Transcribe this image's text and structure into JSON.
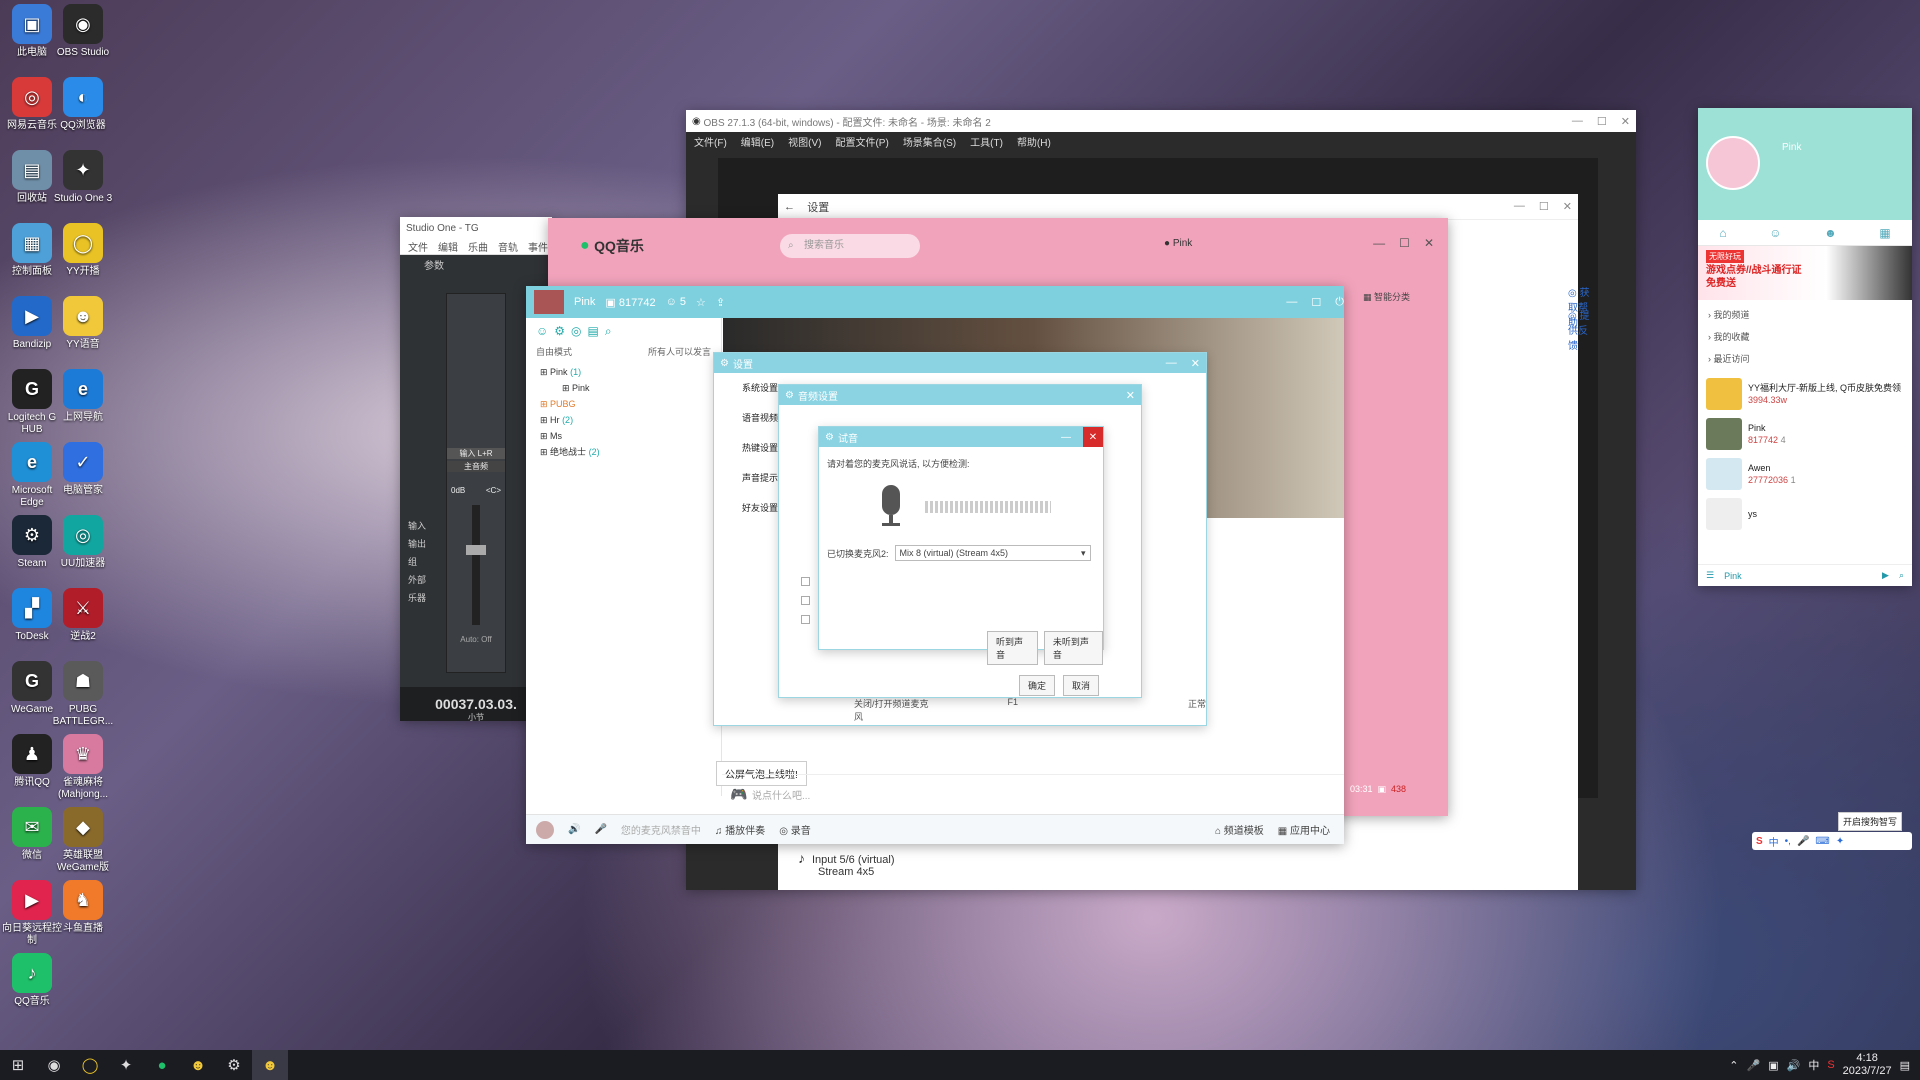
{
  "desktop": {
    "icons": [
      {
        "label": "此电脑",
        "color": "#3b7bd8",
        "glyph": "▣"
      },
      {
        "label": "OBS Studio",
        "color": "#2b2b2b",
        "glyph": "◉"
      },
      {
        "label": "网易云音乐",
        "color": "#d83a3a",
        "glyph": "◎"
      },
      {
        "label": "QQ浏览器",
        "color": "#2a8ce8",
        "glyph": "◐"
      },
      {
        "label": "回收站",
        "color": "#6f8fa8",
        "glyph": "▤"
      },
      {
        "label": "Studio One 3",
        "color": "#333",
        "glyph": "✦"
      },
      {
        "label": "控制面板",
        "color": "#4da0d8",
        "glyph": "▦"
      },
      {
        "label": "YY开播",
        "color": "#e9c325",
        "glyph": "◯"
      },
      {
        "label": "Bandizip",
        "color": "#2369c9",
        "glyph": "▶"
      },
      {
        "label": "YY语音",
        "color": "#f0c83a",
        "glyph": "☻"
      },
      {
        "label": "Logitech G HUB",
        "color": "#222",
        "glyph": "G"
      },
      {
        "label": "上网导航",
        "color": "#1d7bd8",
        "glyph": "e"
      },
      {
        "label": "Microsoft Edge",
        "color": "#1f8fd6",
        "glyph": "e"
      },
      {
        "label": "电脑管家",
        "color": "#2f6fe0",
        "glyph": "✓"
      },
      {
        "label": "Steam",
        "color": "#1b2838",
        "glyph": "⚙"
      },
      {
        "label": "UU加速器",
        "color": "#12a6a0",
        "glyph": "◎"
      },
      {
        "label": "ToDesk",
        "color": "#1f86e0",
        "glyph": "▞"
      },
      {
        "label": "逆战2",
        "color": "#b21d2a",
        "glyph": "⚔"
      },
      {
        "label": "WeGame",
        "color": "#333",
        "glyph": "G"
      },
      {
        "label": "PUBG BATTLEGR...",
        "color": "#5a5a5a",
        "glyph": "☗"
      },
      {
        "label": "腾讯QQ",
        "color": "#222",
        "glyph": "♟"
      },
      {
        "label": "雀魂麻将 (Mahjong...",
        "color": "#d87aa0",
        "glyph": "♛"
      },
      {
        "label": "微信",
        "color": "#2bb24c",
        "glyph": "✉"
      },
      {
        "label": "英雄联盟 WeGame版",
        "color": "#8a6a2b",
        "glyph": "◆"
      },
      {
        "label": "向日葵远程控制",
        "color": "#e0244d",
        "glyph": "▶"
      },
      {
        "label": "斗鱼直播",
        "color": "#f07a2a",
        "glyph": "♞"
      },
      {
        "label": "QQ音乐",
        "color": "#1fc06a",
        "glyph": "♪"
      }
    ]
  },
  "obs": {
    "title": "OBS 27.1.3 (64-bit, windows) - 配置文件: 未命名 - 场景: 未命名 2",
    "menus": [
      "文件(F)",
      "编辑(E)",
      "视图(V)",
      "配置文件(P)",
      "场景集合(S)",
      "工具(T)",
      "帮助(H)"
    ],
    "settings_title": "设置",
    "help_link": "获取帮助",
    "feedback_link": "提供反馈",
    "audio_device": "Input 5/6 (virtual)",
    "audio_stream": "Stream 4x5"
  },
  "studio_one": {
    "title": "Studio One - TG",
    "menus": [
      "文件",
      "编辑",
      "乐曲",
      "音轨",
      "事件"
    ],
    "tab": "参数",
    "input_label": "输入 L+R",
    "main_label": "主音频",
    "db": "0dB",
    "pan": "<C>",
    "side_labels": [
      "输入",
      "输出",
      "组",
      "外部",
      "乐器"
    ],
    "auto": "Auto: Off",
    "time": "00037.03.03.",
    "unit": "小节"
  },
  "qqmusic": {
    "brand": "QQ音乐",
    "search_placeholder": "搜索音乐",
    "user": "Pink",
    "smart": "智能分类"
  },
  "yy": {
    "user": "Pink",
    "uid": "817742",
    "count": "5",
    "mode": "自由模式",
    "notice": "所有人可以发言",
    "tree": [
      {
        "label": "Pink",
        "count": "(1)"
      },
      {
        "label": "Pink",
        "count": ""
      },
      {
        "label": "PUBG",
        "count": ""
      },
      {
        "label": "Hr",
        "count": "(2)"
      },
      {
        "label": "Ms",
        "count": ""
      },
      {
        "label": "绝地战士",
        "count": "(2)"
      }
    ],
    "settings_tabs": [
      "系统设置",
      "语音视频",
      "热键设置",
      "声音提示",
      "好友设置"
    ],
    "hotkey_label": "关闭/打开频道麦克风",
    "hotkey_key": "F1",
    "hotkey_status": "正常",
    "bubble": "公屏气泡上线啦!",
    "chat_placeholder": "说点什么吧...",
    "bottom": {
      "mic_status": "您的麦克风禁音中",
      "player": "播放伴奏",
      "record": "录音",
      "template": "频道模板",
      "apps": "应用中心"
    },
    "chat_stats": {
      "time": "03:31",
      "count": "438"
    }
  },
  "dialogs": {
    "settings": {
      "title": "设置"
    },
    "audio": {
      "title": "音频设置",
      "ok": "确定",
      "cancel": "取消"
    },
    "test": {
      "title": "试音",
      "prompt": "请对着您的麦克风说话, 以方便检测:",
      "switch_label": "已切换麦克风2:",
      "device": "Mix 8 (virtual) (Stream 4x5)",
      "heard": "听到声音",
      "not_heard": "未听到声音"
    }
  },
  "yy_panel": {
    "user": "Pink",
    "banner": "游戏点券//战斗通行证免费送",
    "banner_tag": "无限好玩",
    "sections": [
      "我的频道",
      "我的收藏",
      "最近访问"
    ],
    "rows": [
      {
        "title": "YY福利大厅-新版上线, Q币皮肤免费领",
        "meta": "3994.33w"
      },
      {
        "title": "Pink",
        "meta": "817742",
        "extra": "4"
      },
      {
        "title": "Awen",
        "meta": "27772036",
        "extra": "1"
      },
      {
        "title": "ys",
        "meta": ""
      }
    ],
    "footer_user": "Pink"
  },
  "ime": {
    "label": "开启搜狗智写"
  },
  "taskbar": {
    "time": "4:18",
    "date": "2023/7/27",
    "lang": "中"
  }
}
